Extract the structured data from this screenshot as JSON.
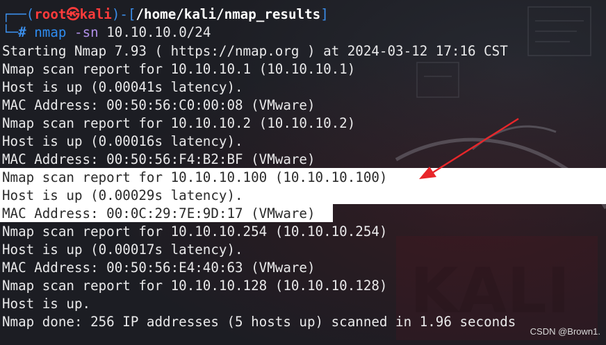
{
  "prompt": {
    "line1_prefix": "┌──(",
    "user": "root",
    "skull": "㉿",
    "host": "kali",
    "mid": ")-[",
    "path": "/home/kali/nmap_results",
    "suffix": "]",
    "line2_prefix": "└─",
    "hash": "#",
    "command": "nmap",
    "option": "-sn",
    "target": "10.10.10.0/24"
  },
  "output": [
    "Starting Nmap 7.93 ( https://nmap.org ) at 2024-03-12 17:16 CST",
    "Nmap scan report for 10.10.10.1 (10.10.10.1)",
    "Host is up (0.00041s latency).",
    "MAC Address: 00:50:56:C0:00:08 (VMware)",
    "Nmap scan report for 10.10.10.2 (10.10.10.2)",
    "Host is up (0.00016s latency).",
    "MAC Address: 00:50:56:F4:B2:BF (VMware)",
    "Nmap scan report for 10.10.10.100 (10.10.10.100)",
    "Host is up (0.00029s latency).",
    "MAC Address: 00:0C:29:7E:9D:17 (VMware)",
    "Nmap scan report for 10.10.10.254 (10.10.10.254)",
    "Host is up (0.00017s latency).",
    "MAC Address: 00:50:56:E4:40:63 (VMware)",
    "Nmap scan report for 10.10.10.128 (10.10.10.128)",
    "Host is up.",
    "Nmap done: 256 IP addresses (5 hosts up) scanned in 1.96 seconds"
  ],
  "highlighted_lines": [
    7,
    8,
    9
  ],
  "watermark": "CSDN @Brown1.",
  "colors": {
    "background": "#1c1d23",
    "prompt_frame": "#3b8eea",
    "prompt_user": "#ff3b3b",
    "output_text": "#e9e9ea",
    "highlight": "#ffffff",
    "annotation_arrow": "#e8262a"
  }
}
